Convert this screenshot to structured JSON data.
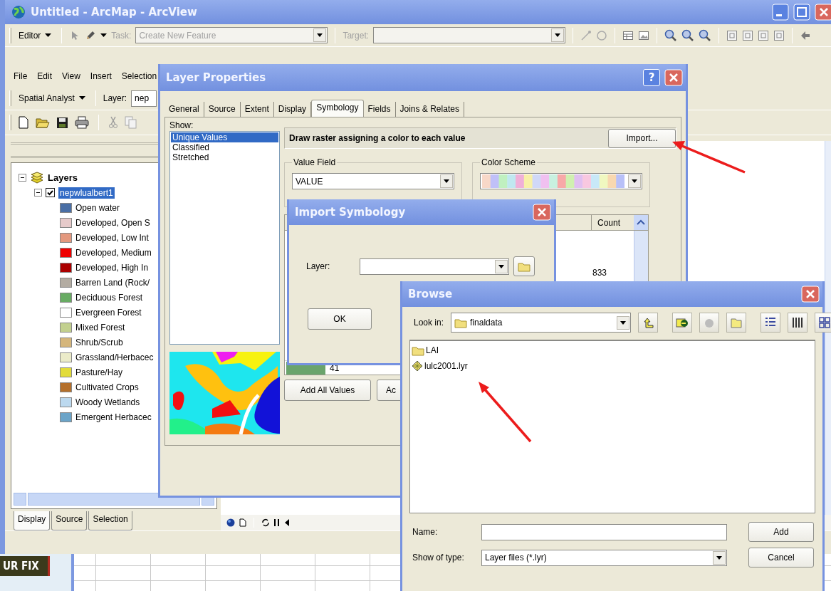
{
  "window": {
    "title": "Untitled - ArcMap - ArcView"
  },
  "editor_toolbar": {
    "editor_menu": "Editor",
    "task": {
      "label": "Task:",
      "value": "Create New Feature",
      "disabled": true
    },
    "target": {
      "label": "Target:",
      "disabled": true
    }
  },
  "menu_bar": [
    "File",
    "Edit",
    "View",
    "Insert",
    "Selection"
  ],
  "spatial_analyst_toolbar": {
    "menu": "Spatial Analyst",
    "layer_label": "Layer:",
    "layer_value": "nep"
  },
  "toc": {
    "layers": {
      "label": "Layers",
      "expanded": true,
      "children": [
        {
          "label": "nepwlualbert1",
          "expanded": true,
          "checked": true,
          "selected": true,
          "legend": [
            {
              "label": "Open water",
              "color": "#4a6fa5"
            },
            {
              "label": "Developed, Open S",
              "color": "#e6caca"
            },
            {
              "label": "Developed, Low Int",
              "color": "#e3987e"
            },
            {
              "label": "Developed, Medium",
              "color": "#ee0000"
            },
            {
              "label": "Developed, High In",
              "color": "#ab0000"
            },
            {
              "label": "Barren Land (Rock/",
              "color": "#b3aca2"
            },
            {
              "label": "Deciduous Forest",
              "color": "#68ab63"
            },
            {
              "label": "Evergreen Forest",
              "color": "#ffffff"
            },
            {
              "label": "Mixed Forest",
              "color": "#c2d08f"
            },
            {
              "label": "Shrub/Scrub",
              "color": "#d5b67c"
            },
            {
              "label": "Grassland/Herbacec",
              "color": "#ebebc9"
            },
            {
              "label": "Pasture/Hay",
              "color": "#e2dc3a"
            },
            {
              "label": "Cultivated Crops",
              "color": "#b4702c"
            },
            {
              "label": "Woody Wetlands",
              "color": "#bcd9ef"
            },
            {
              "label": "Emergent Herbacec",
              "color": "#6ba4c8"
            }
          ]
        }
      ]
    },
    "tabs": [
      {
        "label": "Display",
        "selected": true
      },
      {
        "label": "Source",
        "selected": false
      },
      {
        "label": "Selection",
        "selected": false
      }
    ]
  },
  "layer_properties": {
    "title": "Layer Properties",
    "help_button": "?",
    "tabs": [
      {
        "label": "General",
        "selected": false
      },
      {
        "label": "Source",
        "selected": false
      },
      {
        "label": "Extent",
        "selected": false
      },
      {
        "label": "Display",
        "selected": false
      },
      {
        "label": "Symbology",
        "selected": true
      },
      {
        "label": "Fields",
        "selected": false
      },
      {
        "label": "Joins & Relates",
        "selected": false
      }
    ],
    "show_label": "Show:",
    "show_items": [
      {
        "label": "Unique Values",
        "selected": true
      },
      {
        "label": "Classified",
        "selected": false
      },
      {
        "label": "Stretched",
        "selected": false
      }
    ],
    "description": "Draw raster assigning a color to each value",
    "import_button": "Import...",
    "value_field": {
      "label": "Value Field",
      "value": "VALUE"
    },
    "color_scheme": {
      "label": "Color Scheme"
    },
    "table": {
      "columns": [
        "Count"
      ],
      "cells": [
        "833"
      ],
      "last_row": {
        "value": "41",
        "color": "#6aa46c"
      }
    },
    "buttons": [
      "Add All Values",
      "Ac"
    ]
  },
  "import_symbology": {
    "title": "Import Symbology",
    "layer_label": "Layer:",
    "ok_button": "OK"
  },
  "browse": {
    "title": "Browse",
    "look_in_label": "Look in:",
    "look_in": "finaldata",
    "items": [
      {
        "name": "LAI",
        "kind": "folder",
        "selected": false
      },
      {
        "name": "lulc2001.lyr",
        "kind": "layer",
        "selected": false
      }
    ],
    "name_label": "Name:",
    "type_label": "Show of type:",
    "type_value": "Layer files (*.lyr)",
    "add_button": "Add",
    "cancel_button": "Cancel"
  },
  "background_window": {
    "banner": "UR FIX"
  }
}
